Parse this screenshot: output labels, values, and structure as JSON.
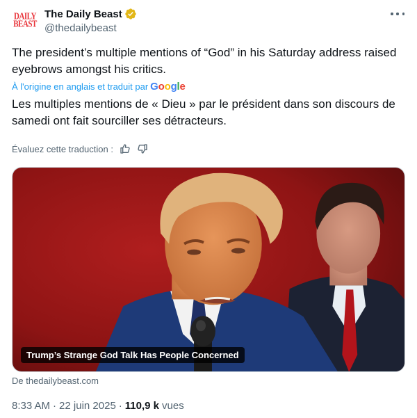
{
  "author": {
    "name": "The Daily Beast",
    "handle": "@thedailybeast",
    "avatar_text": [
      "DAILY",
      "BEAST"
    ],
    "verified_color": "#e2b719",
    "brand_color": "#e8343a"
  },
  "tweet": {
    "original_text": "The president’s multiple mentions of “God” in his Saturday address raised eyebrows amongst his critics.",
    "translated_label": "À l'origine en anglais et traduit par",
    "translator": "Google",
    "translated_text": "Les multiples mentions de « Dieu » par le président dans son discours de samedi ont fait sourciller ses détracteurs.",
    "rate_label": "Évaluez cette traduction :"
  },
  "card": {
    "caption": "Trump’s Strange God Talk Has People Concerned",
    "source": "De thedailybeast.com"
  },
  "meta": {
    "time": "8:33 AM",
    "date": "22 juin 2025",
    "views_count": "110,9 k",
    "views_label": "vues"
  },
  "colors": {
    "link": "#1d9bf0",
    "secondary_text": "#536471",
    "primary_text": "#0f1419"
  },
  "icons": [
    "verified-badge-icon",
    "more-options-icon",
    "thumbs-up-icon",
    "thumbs-down-icon"
  ]
}
